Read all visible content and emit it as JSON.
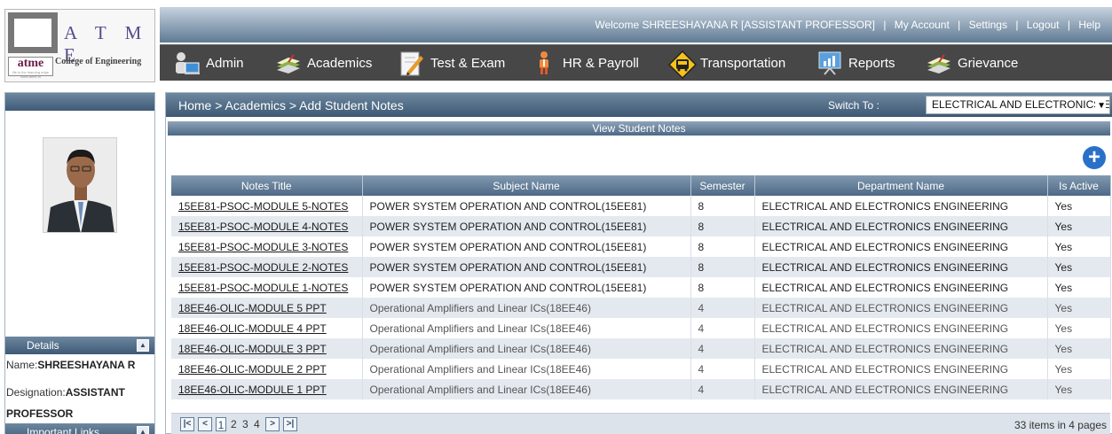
{
  "logo": {
    "name": "A T M E",
    "short": "atme",
    "tagline": "College of Engineering",
    "motto": "life is the learning edge",
    "url": "www.atme.in"
  },
  "topbar": {
    "welcome": "Welcome SHREESHAYANA R [ASSISTANT PROFESSOR]",
    "sep": "|",
    "my_account": "My Account",
    "settings": "Settings",
    "logout": "Logout",
    "help": "Help"
  },
  "menu": [
    {
      "label": "Admin",
      "icon": "admin-user-icon"
    },
    {
      "label": "Academics",
      "icon": "books-icon"
    },
    {
      "label": "Test & Exam",
      "icon": "pencil-notepad-icon"
    },
    {
      "label": "HR & Payroll",
      "icon": "person-icon"
    },
    {
      "label": "Transportation",
      "icon": "bus-sign-icon"
    },
    {
      "label": "Reports",
      "icon": "chart-board-icon"
    },
    {
      "label": "Grievance",
      "icon": "books-icon"
    }
  ],
  "breadcrumb": "Home > Academics > Add Student Notes",
  "switch_to": {
    "label": "Switch To :",
    "value": "ELECTRICAL AND ELECTRONICS ENGINEERING"
  },
  "section_title": "View Student Notes",
  "table": {
    "columns": [
      "Notes Title",
      "Subject Name",
      "Semester",
      "Department Name",
      "Is Active"
    ],
    "rows": [
      [
        "15EE81-PSOC-MODULE 5-NOTES",
        "POWER SYSTEM OPERATION AND CONTROL(15EE81)",
        "8",
        "ELECTRICAL AND ELECTRONICS ENGINEERING",
        "Yes"
      ],
      [
        "15EE81-PSOC-MODULE 4-NOTES",
        "POWER SYSTEM OPERATION AND CONTROL(15EE81)",
        "8",
        "ELECTRICAL AND ELECTRONICS ENGINEERING",
        "Yes"
      ],
      [
        "15EE81-PSOC-MODULE 3-NOTES",
        "POWER SYSTEM OPERATION AND CONTROL(15EE81)",
        "8",
        "ELECTRICAL AND ELECTRONICS ENGINEERING",
        "Yes"
      ],
      [
        "15EE81-PSOC-MODULE 2-NOTES",
        "POWER SYSTEM OPERATION AND CONTROL(15EE81)",
        "8",
        "ELECTRICAL AND ELECTRONICS ENGINEERING",
        "Yes"
      ],
      [
        "15EE81-PSOC-MODULE 1-NOTES",
        "POWER SYSTEM OPERATION AND CONTROL(15EE81)",
        "8",
        "ELECTRICAL AND ELECTRONICS ENGINEERING",
        "Yes"
      ],
      [
        "18EE46-OLIC-MODULE 5 PPT",
        "Operational Amplifiers and Linear ICs(18EE46)",
        "4",
        "ELECTRICAL AND ELECTRONICS ENGINEERING",
        "Yes"
      ],
      [
        "18EE46-OLIC-MODULE 4 PPT",
        "Operational Amplifiers and Linear ICs(18EE46)",
        "4",
        "ELECTRICAL AND ELECTRONICS ENGINEERING",
        "Yes"
      ],
      [
        "18EE46-OLIC-MODULE 3 PPT",
        "Operational Amplifiers and Linear ICs(18EE46)",
        "4",
        "ELECTRICAL AND ELECTRONICS ENGINEERING",
        "Yes"
      ],
      [
        "18EE46-OLIC-MODULE 2 PPT",
        "Operational Amplifiers and Linear ICs(18EE46)",
        "4",
        "ELECTRICAL AND ELECTRONICS ENGINEERING",
        "Yes"
      ],
      [
        "18EE46-OLIC-MODULE 1 PPT",
        "Operational Amplifiers and Linear ICs(18EE46)",
        "4",
        "ELECTRICAL AND ELECTRONICS ENGINEERING",
        "Yes"
      ]
    ]
  },
  "pager": {
    "pages": [
      "1",
      "2",
      "3",
      "4"
    ],
    "current": "1",
    "info": "33 items in 4 pages"
  },
  "sidebar": {
    "details_title": "Details",
    "name_label": "Name:",
    "name_value": "SHREESHAYANA R",
    "designation_label": "Designation:",
    "designation_value": "ASSISTANT PROFESSOR",
    "links_title": "Important Links"
  },
  "colors": {
    "menu_bg": "#474747",
    "header_blue": "#4e6987",
    "row_alt": "#e4e9ef",
    "add_button": "#2a70c8"
  }
}
